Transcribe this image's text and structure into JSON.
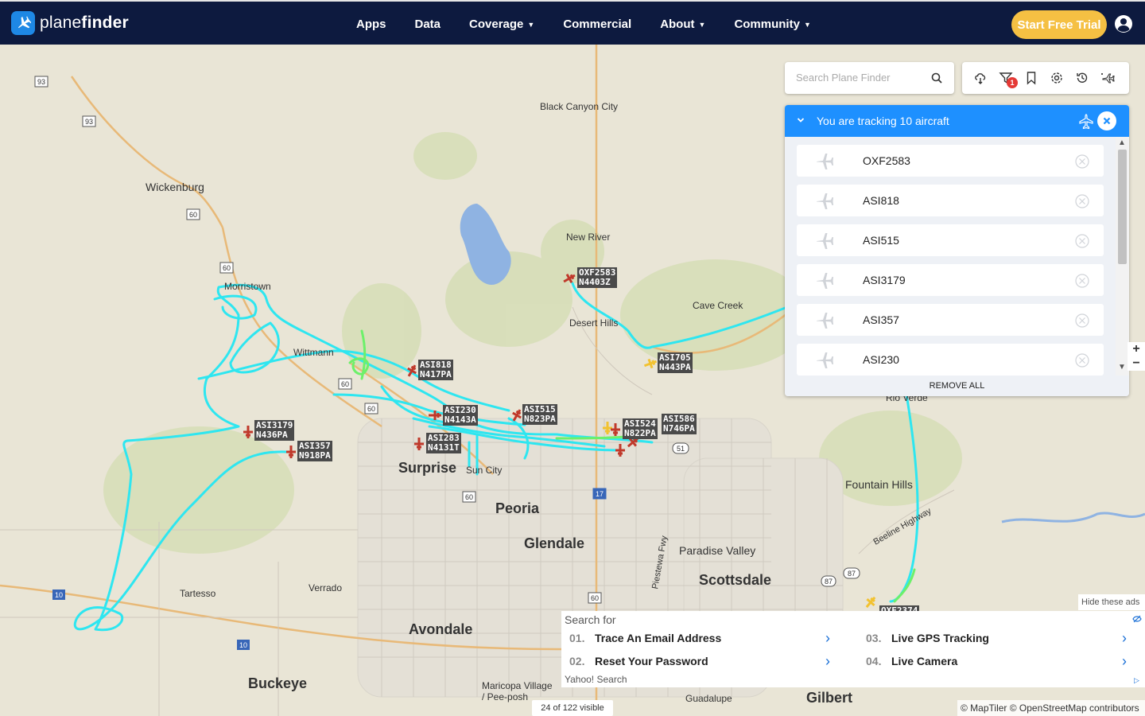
{
  "header": {
    "logo_plain": "plane",
    "logo_bold": "finder",
    "nav": [
      {
        "label": "Apps",
        "dropdown": false
      },
      {
        "label": "Data",
        "dropdown": false
      },
      {
        "label": "Coverage",
        "dropdown": true
      },
      {
        "label": "Commercial",
        "dropdown": false
      },
      {
        "label": "About",
        "dropdown": true
      },
      {
        "label": "Community",
        "dropdown": true
      }
    ],
    "cta_label": "Start Free Trial",
    "user_icon": "user-circle-icon"
  },
  "search": {
    "placeholder": "Search Plane Finder",
    "value": "",
    "icon": "search-icon"
  },
  "toolbar": {
    "filter_badge": "1",
    "icons": [
      "weather-icon",
      "filter-icon",
      "bookmark-icon",
      "settings-icon",
      "history-icon",
      "ar-icon"
    ]
  },
  "tracking": {
    "title": "You are tracking 10 aircraft",
    "items": [
      "OXF2583",
      "ASI818",
      "ASI515",
      "ASI3179",
      "ASI357",
      "ASI230"
    ],
    "remove_all": "REMOVE ALL"
  },
  "map": {
    "places": {
      "black_canyon_city": "Black Canyon City",
      "wickenburg": "Wickenburg",
      "new_river": "New River",
      "morristown": "Morristown",
      "cave_creek": "Cave Creek",
      "desert_hills": "Desert Hills",
      "wittmann": "Wittmann",
      "rio_verde": "Rio Verde",
      "surprise": "Surprise",
      "sun_city": "Sun City",
      "peoria": "Peoria",
      "fountain_hills": "Fountain Hills",
      "glendale": "Glendale",
      "paradise_valley": "Paradise Valley",
      "scottsdale": "Scottsdale",
      "tartesso": "Tartesso",
      "verrado": "Verrado",
      "avondale": "Avondale",
      "buckeye": "Buckeye",
      "maricopa_village": "Maricopa Village\n/ Pee-posh",
      "guadalupe": "Guadalupe",
      "gilbert": "Gilbert",
      "beeline_highway": "Beeline Highway",
      "piestewa_fwy": "Piestewa Fwy"
    },
    "aircraft_labels": {
      "oxf2583": "OXF2583\nN4403Z",
      "asi818": "ASI818\nN417PA",
      "asi705": "ASI705\nN443PA",
      "asi515": "ASI515\nN823PA",
      "asi230": "ASI230\nN4143A",
      "asi3179": "ASI3179\nN436PA",
      "asi524": "ASI524\nN822PA",
      "asi586": "ASI586\nN746PA",
      "asi283": "ASI283\nN4131T",
      "asi357": "ASI357\nN918PA",
      "oxf_partial": "OXF2374"
    },
    "shields": {
      "s93a": "93",
      "s93b": "93",
      "s60a": "60",
      "s60b": "60",
      "s60c": "60",
      "s60d": "60",
      "s60e": "60",
      "s60f": "60",
      "s51": "51",
      "s17": "17",
      "s87a": "87",
      "s87b": "87",
      "s10a": "10",
      "s10b": "10"
    },
    "zoom_in": "+",
    "zoom_out": "−",
    "visible_count": "24 of 122 visible",
    "attribution": "© MapTiler © OpenStreetMap contributors"
  },
  "ad": {
    "hide_label": "Hide these ads",
    "search_for": "Search for",
    "items": [
      {
        "num": "01.",
        "text": "Trace An Email Address"
      },
      {
        "num": "03.",
        "text": "Live GPS Tracking"
      },
      {
        "num": "02.",
        "text": "Reset Your Password"
      },
      {
        "num": "04.",
        "text": "Live Camera"
      }
    ],
    "footer": "Yahoo! Search"
  },
  "colors": {
    "nav_bg": "#0d1a3f",
    "cta": "#f5c043",
    "panel_header": "#1e90ff",
    "track_cyan": "#2ee6f0",
    "track_green": "#6df06a",
    "plane_red": "#c0392b",
    "plane_yellow": "#f2c230"
  }
}
